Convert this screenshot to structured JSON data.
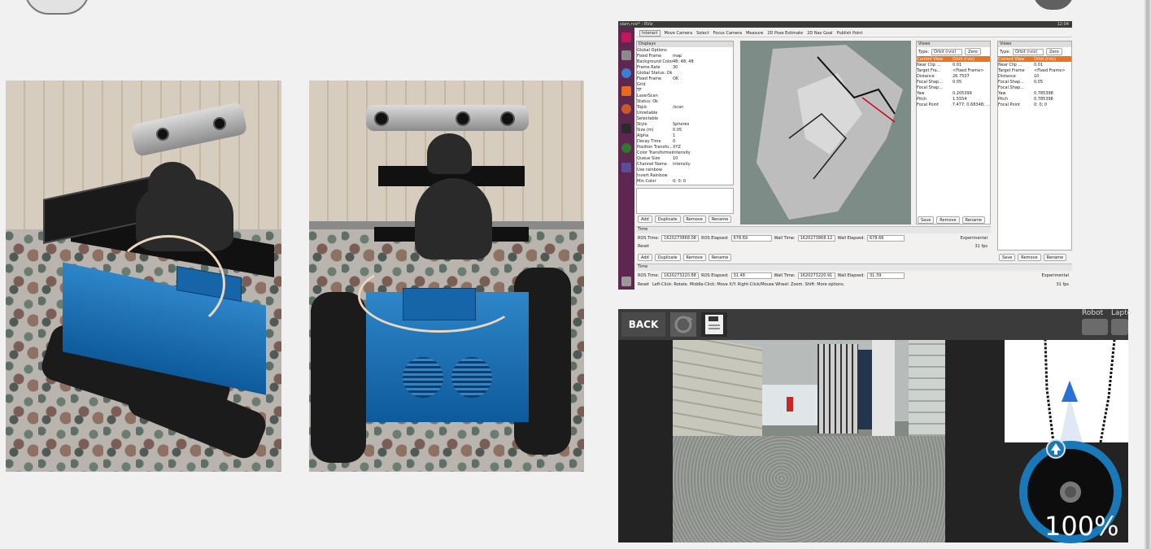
{
  "rviz": {
    "window_title": "slam.rviz* - RViz",
    "clock": "12:04",
    "toolbar": [
      "Interact",
      "Move Camera",
      "Select",
      "Focus Camera",
      "Measure",
      "2D Pose Estimate",
      "2D Nav Goal",
      "Publish Point"
    ],
    "displays_header": "Displays",
    "displays": [
      {
        "k": "Global Options",
        "v": ""
      },
      {
        "k": "Fixed Frame",
        "v": "map"
      },
      {
        "k": "Background Color",
        "v": "48; 48; 48"
      },
      {
        "k": "Frame Rate",
        "v": "30"
      },
      {
        "k": "Global Status: Ok",
        "v": ""
      },
      {
        "k": "Fixed Frame",
        "v": "OK"
      },
      {
        "k": "Grid",
        "v": ""
      },
      {
        "k": "TF",
        "v": ""
      },
      {
        "k": "LaserScan",
        "v": ""
      },
      {
        "k": "Status: Ok",
        "v": ""
      },
      {
        "k": "Topic",
        "v": "/scan"
      },
      {
        "k": "Unreliable",
        "v": ""
      },
      {
        "k": "Selectable",
        "v": ""
      },
      {
        "k": "Style",
        "v": "Spheres"
      },
      {
        "k": "Size (m)",
        "v": "0.05"
      },
      {
        "k": "Alpha",
        "v": "1"
      },
      {
        "k": "Decay Time",
        "v": "0"
      },
      {
        "k": "Position Transfo...",
        "v": "XYZ"
      },
      {
        "k": "Color Transformer",
        "v": "Intensity"
      },
      {
        "k": "Queue Size",
        "v": "10"
      },
      {
        "k": "Channel Name",
        "v": "intensity"
      },
      {
        "k": "Use rainbow",
        "v": ""
      },
      {
        "k": "Invert Rainbow",
        "v": ""
      },
      {
        "k": "Min Color",
        "v": "0; 0; 0"
      }
    ],
    "buttons": {
      "add": "Add",
      "duplicate": "Duplicate",
      "remove": "Remove",
      "rename": "Rename",
      "save": "Save",
      "zero": "Zero",
      "reset": "Reset"
    },
    "views_header": "Views",
    "views_type_label": "Type:",
    "views_type_value": "Orbit (rviz)",
    "views_left": [
      {
        "k": "Current View",
        "v": "Orbit (rviz)"
      },
      {
        "k": "Near Clip ...",
        "v": "0.01"
      },
      {
        "k": "Target Fra...",
        "v": "<Fixed Frame>"
      },
      {
        "k": "Distance",
        "v": "26.7507"
      },
      {
        "k": "Focal Shap...",
        "v": "0.05"
      },
      {
        "k": "Focal Shap...",
        "v": ""
      },
      {
        "k": "Yaw",
        "v": "0.205399"
      },
      {
        "k": "Pitch",
        "v": "1.5554"
      },
      {
        "k": "Focal Point",
        "v": "7.477; 0.68348; ..."
      }
    ],
    "views_right": [
      {
        "k": "Current View",
        "v": "Orbit (rviz)"
      },
      {
        "k": "Near Clip ...",
        "v": "0.01"
      },
      {
        "k": "Target Frame",
        "v": "<Fixed Frame>"
      },
      {
        "k": "Distance",
        "v": "10"
      },
      {
        "k": "Focal Shap...",
        "v": "0.05"
      },
      {
        "k": "Focal Shap...",
        "v": ""
      },
      {
        "k": "Yaw",
        "v": "0.785398"
      },
      {
        "k": "Pitch",
        "v": "0.785398"
      },
      {
        "k": "Focal Point",
        "v": "0; 0; 0"
      }
    ],
    "time_header": "Time",
    "time_a": {
      "ros_time_label": "ROS Time:",
      "ros_time": "1620273868.08",
      "ros_elapsed_label": "ROS Elapsed:",
      "ros_elapsed": "678.69",
      "wall_time_label": "Wall Time:",
      "wall_time": "1620273868.12",
      "wall_elapsed_label": "Wall Elapsed:",
      "wall_elapsed": "678.66"
    },
    "time_b": {
      "ros_time": "1620273220.88",
      "ros_elapsed": "31.48",
      "wall_time": "1620273220.91",
      "wall_elapsed": "31.39"
    },
    "experimental": "Experimental",
    "fps": "31 fps",
    "status_hint": "Left-Click: Rotate. Middle-Click: Move X/Y. Right-Click/Mouse Wheel: Zoom. Shift: More options."
  },
  "app": {
    "back_label": "BACK",
    "robot_label": "Robot",
    "laptop_label": "Lapto",
    "speed_percent": "100%",
    "icons": [
      "refresh-icon",
      "save-icon",
      "arrow-up-icon"
    ]
  },
  "colors": {
    "rviz_launcher": "#5e2750",
    "accent_blue": "#1978b8",
    "app_bg": "#232323"
  }
}
